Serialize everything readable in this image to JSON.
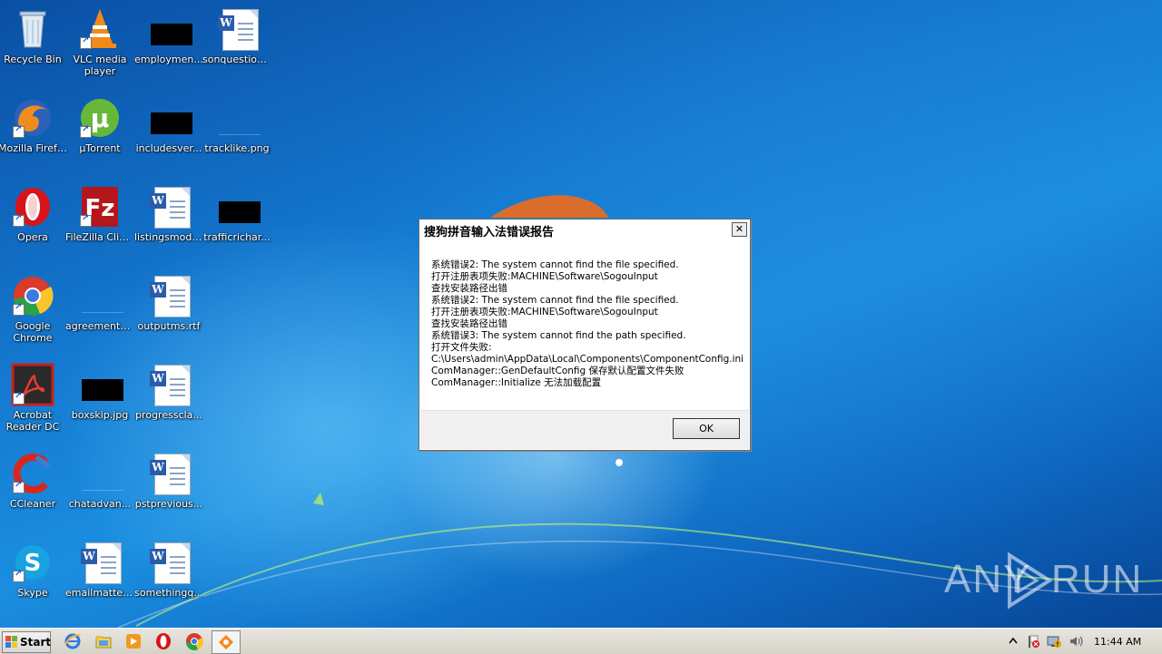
{
  "desktop": {
    "icons": [
      {
        "label": "Recycle Bin"
      },
      {
        "label": "VLC media player"
      },
      {
        "label": "employmen..."
      },
      {
        "label": "sonquestion..."
      },
      {
        "label": "Mozilla Firefox"
      },
      {
        "label": "µTorrent"
      },
      {
        "label": "includesver..."
      },
      {
        "label": "tracklike.png"
      },
      {
        "label": "Opera"
      },
      {
        "label": "FileZilla Client"
      },
      {
        "label": "listingsmodi..."
      },
      {
        "label": "trafficrichar..."
      },
      {
        "label": "Google Chrome"
      },
      {
        "label": "agreementc..."
      },
      {
        "label": "outputms.rtf"
      },
      {
        "label": "Acrobat Reader DC"
      },
      {
        "label": "boxskip.jpg"
      },
      {
        "label": "progresscla..."
      },
      {
        "label": "CCleaner"
      },
      {
        "label": "chatadvan..."
      },
      {
        "label": "pstprevious..."
      },
      {
        "label": "Skype"
      },
      {
        "label": "emailmatter..."
      },
      {
        "label": "somethingq..."
      }
    ]
  },
  "dialog": {
    "title": "搜狗拼音输入法错误报告",
    "close_glyph": "✕",
    "lines": [
      "系统错误2: The system cannot find the file specified.",
      "打开注册表项失败:MACHINE\\Software\\SogouInput",
      "查找安装路径出错",
      "系统错误2: The system cannot find the file specified.",
      "打开注册表项失败:MACHINE\\Software\\SogouInput",
      "查找安装路径出错",
      "系统错误3: The system cannot find the path specified.",
      "打开文件失败:",
      "C:\\Users\\admin\\AppData\\Local\\Components\\ComponentConfig.ini",
      "ComManager::GenDefaultConfig 保存默认配置文件失败",
      "ComManager::Initialize 无法加载配置"
    ],
    "ok_label": "OK"
  },
  "watermark": {
    "left": "ANY",
    "right": "RUN"
  },
  "taskbar": {
    "start_label": "Start",
    "clock": "11:44 AM",
    "pinned": [
      "internet-explorer-icon",
      "explorer-icon",
      "media-player-icon",
      "opera-icon",
      "chrome-icon",
      "sogou-app-icon"
    ]
  },
  "colors": {
    "accent": "#1a7bd6",
    "taskbar": "#d8d5cc"
  }
}
